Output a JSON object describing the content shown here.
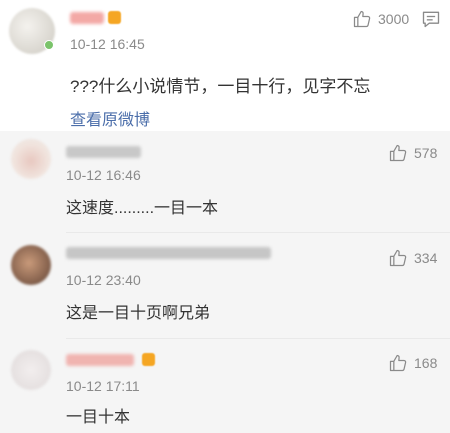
{
  "main_comment": {
    "time": "10-12 16:45",
    "likes": "3000",
    "content": "???什么小说情节，一目十行，见字不忘",
    "view_original": "查看原微博",
    "icons": {
      "like": "thumbs-up-icon",
      "comment": "comment-icon"
    }
  },
  "replies": [
    {
      "time": "10-12 16:46",
      "likes": "578",
      "content": "这速度.........一目一本"
    },
    {
      "time": "10-12 23:40",
      "likes": "334",
      "content": "这是一目十页啊兄弟"
    },
    {
      "time": "10-12 17:11",
      "likes": "168",
      "content": "一目十本"
    }
  ],
  "colors": {
    "link": "#4b6eaa",
    "reply_bg": "#f5f5f5",
    "muted": "#8a8a8a"
  }
}
